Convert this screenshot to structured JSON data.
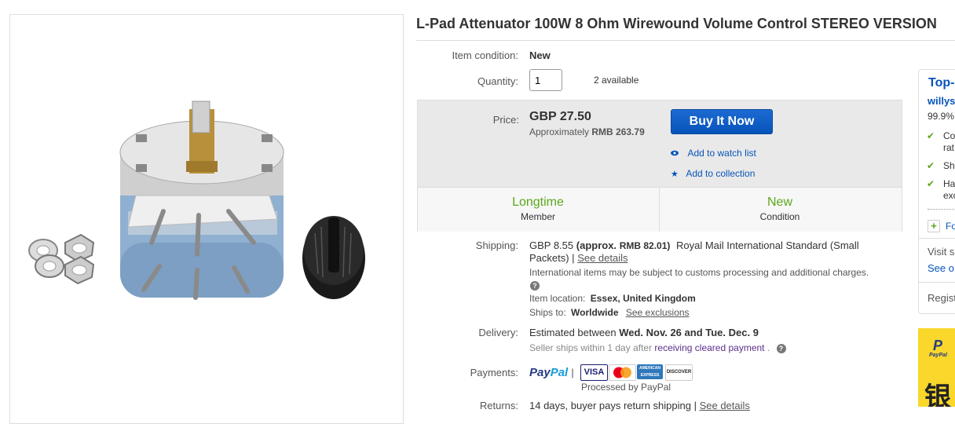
{
  "title": "L-Pad Attenuator 100W 8 Ohm Wirewound Volume Control STEREO VERSION",
  "condition": {
    "label": "Item condition:",
    "value": "New"
  },
  "quantity": {
    "label": "Quantity:",
    "value": "1",
    "available": "2 available"
  },
  "price": {
    "label": "Price:",
    "value": "GBP 27.50",
    "approx_prefix": "Approximately",
    "approx_value": "RMB 263.79",
    "buy_label": "Buy It Now",
    "watch_label": "Add to watch list",
    "collection_label": "Add to collection"
  },
  "badges": [
    {
      "title": "Longtime",
      "subtitle": "Member"
    },
    {
      "title": "New",
      "subtitle": "Condition"
    }
  ],
  "shipping": {
    "label": "Shipping:",
    "cost": "GBP 8.55",
    "approx": "(approx.",
    "approx_rmb": "RMB 82.01)",
    "service_line1": "Royal Mail International Standard (Small",
    "service_line2": "Packets) |",
    "details_link": "See details",
    "customs_note": "International items may be subject to customs processing and additional charges.",
    "location_label": "Item location:",
    "location": "Essex, United Kingdom",
    "ships_to_label": "Ships to:",
    "ships_to": "Worldwide",
    "exclusions_link": "See exclusions"
  },
  "delivery": {
    "label": "Delivery:",
    "prefix": "Estimated between",
    "dates": "Wed. Nov. 26 and Tue. Dec. 9",
    "seller_ships": "Seller ships within 1 day after",
    "cleared_link": "receiving cleared payment",
    "period": "."
  },
  "payments": {
    "label": "Payments:",
    "paypal_pay": "Pay",
    "paypal_pal": "Pal",
    "pipe": "|",
    "processed": "Processed by PayPal",
    "cards": [
      "VISA",
      "MasterCard",
      "AMERICAN EXPRESS",
      "DISCOVER"
    ]
  },
  "returns": {
    "label": "Returns:",
    "text": "14 days, buyer pays return shipping |",
    "details_link": "See details"
  },
  "seller_panel": {
    "heading": "Top-",
    "username": "willys",
    "feedback": "99.9%",
    "items": [
      "Co",
      "rat",
      "Sh",
      "Ha",
      "exc"
    ],
    "follow": "Fo",
    "visit": "Visit s",
    "see_other": "See o",
    "register": "Regist"
  },
  "ad": {
    "paypal": "PayPal",
    "chinese": "银"
  },
  "colors": {
    "accent_blue": "#0654ba",
    "green": "#5ba71b",
    "price_bg": "#e9e9e9",
    "ad_yellow": "#f9d72b"
  }
}
